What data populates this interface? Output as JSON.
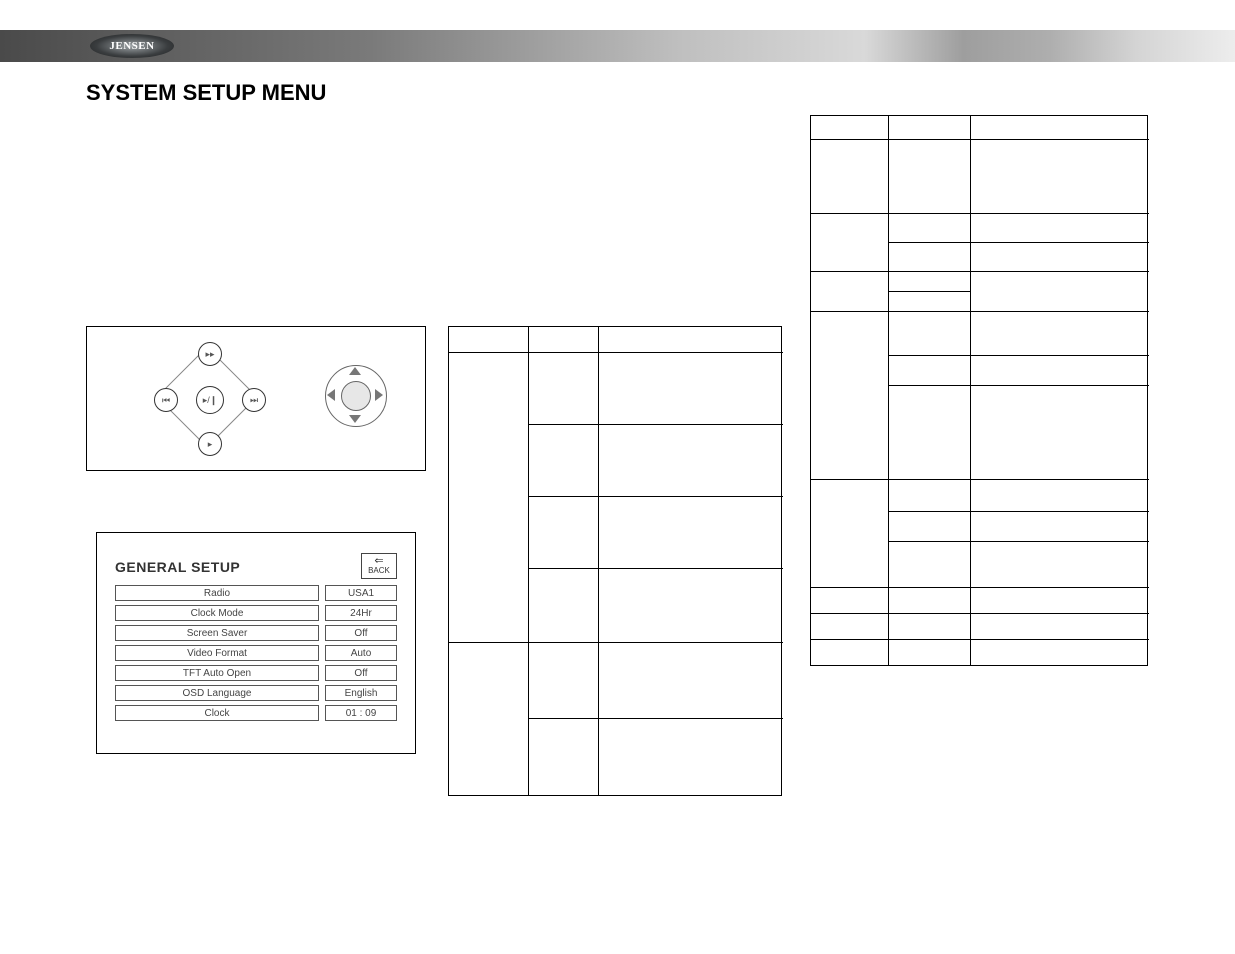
{
  "brand": "JENSEN",
  "title": "SYSTEM SETUP MENU",
  "controls": {
    "center": "▸/❙",
    "up": "▸▸",
    "down": "▸",
    "left": "⏮",
    "right": "⏭"
  },
  "screen": {
    "title": "GENERAL SETUP",
    "back_arrow": "⇐",
    "back_label": "BACK",
    "rows": [
      {
        "key": "Radio",
        "val": "USA1"
      },
      {
        "key": "Clock  Mode",
        "val": "24Hr"
      },
      {
        "key": "Screen Saver",
        "val": "Off"
      },
      {
        "key": "Video Format",
        "val": "Auto"
      },
      {
        "key": "TFT Auto Open",
        "val": "Off"
      },
      {
        "key": "OSD Language",
        "val": "English"
      },
      {
        "key": "Clock",
        "val": "01  :  09"
      }
    ]
  }
}
